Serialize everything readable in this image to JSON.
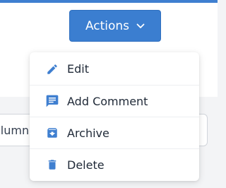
{
  "actions": {
    "label": "Actions",
    "chevron_icon": "chevron-down-icon"
  },
  "columns_field": {
    "value_partial": "olumn"
  },
  "menu": {
    "items": [
      {
        "label": "Edit",
        "icon": "pencil-icon"
      },
      {
        "label": "Add Comment",
        "icon": "comment-icon"
      },
      {
        "label": "Archive",
        "icon": "archive-icon"
      },
      {
        "label": "Delete",
        "icon": "trash-icon"
      }
    ]
  },
  "colors": {
    "accent": "#3b7ed0",
    "icon": "#3f7fd0",
    "text": "#1f2937"
  }
}
